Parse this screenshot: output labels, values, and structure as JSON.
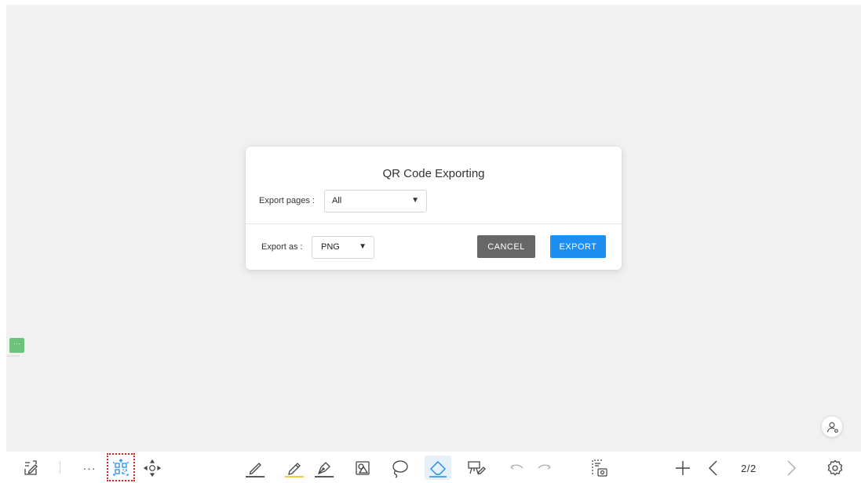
{
  "dialog": {
    "title": "QR Code Exporting",
    "export_pages_label": "Export pages :",
    "export_pages_value": "All",
    "export_as_label": "Export as :",
    "export_as_value": "PNG",
    "cancel_label": "CANCEL",
    "export_label": "EXPORT"
  },
  "side_chip": {
    "label": "···"
  },
  "toolbar": {
    "more_label": "···",
    "page_indicator": "2/2",
    "icons": [
      "notes-icon",
      "more-icon",
      "qr-code-icon",
      "move-icon",
      "pen-icon",
      "highlighter-icon",
      "calligraphy-pen-icon",
      "shape-icon",
      "lasso-icon",
      "eraser-icon",
      "presentation-icon",
      "undo-icon",
      "redo-icon",
      "screenshot-icon",
      "add-page-icon",
      "prev-page-icon",
      "next-page-icon",
      "settings-icon"
    ]
  },
  "colors": {
    "accent": "#1e8ef0",
    "cancel": "#676767",
    "highlighter": "#f5c842",
    "canvas": "#f1f1f1",
    "active_bg": "#e6f0fb"
  }
}
